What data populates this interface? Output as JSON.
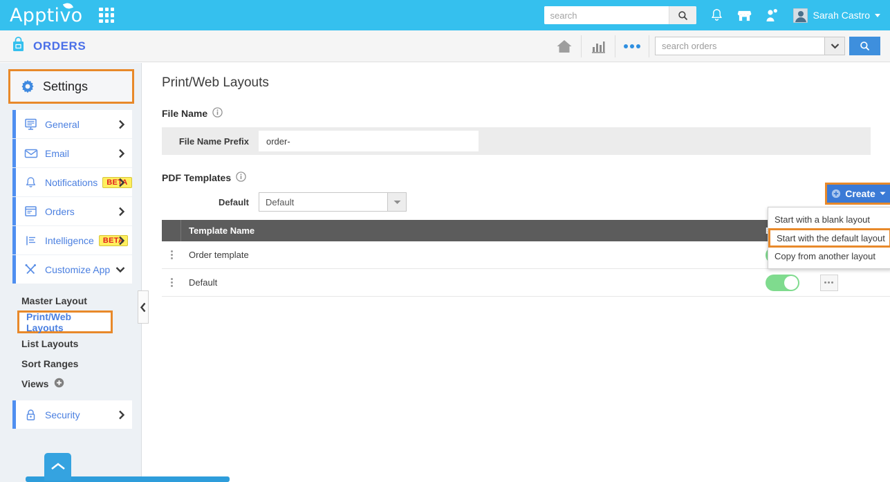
{
  "topbar": {
    "brand": "Apptivo",
    "grid_icon": "apps-grid-icon",
    "search_placeholder": "search",
    "search_value": "",
    "search_icon": "search-icon",
    "bell_icon": "notifications-bell-icon",
    "store_icon": "store-icon",
    "person_icon": "person-icon",
    "avatar_icon": "user-avatar",
    "username": "Sarah Castro",
    "caret_icon": "chevron-down-icon"
  },
  "appheader": {
    "app_icon": "shopping-bag-icon",
    "app_title": "ORDERS",
    "home_icon": "home-icon",
    "reports_icon": "bar-chart-icon",
    "more_icon": "more-dots-icon",
    "search_placeholder": "search orders",
    "search_value": "",
    "dropdown_icon": "chevron-down-icon",
    "search_button_icon": "search-icon"
  },
  "sidebar": {
    "header": {
      "label": "Settings",
      "icon": "gear-icon"
    },
    "items": [
      {
        "label": "General",
        "icon": "monitor-icon",
        "beta": "",
        "chevron": "chevron-right-icon"
      },
      {
        "label": "Email",
        "icon": "envelope-icon",
        "beta": "",
        "chevron": "chevron-right-icon"
      },
      {
        "label": "Notifications",
        "icon": "bell-icon",
        "beta": "BETA",
        "chevron": "chevron-right-icon"
      },
      {
        "label": "Orders",
        "icon": "document-icon",
        "beta": "",
        "chevron": "chevron-right-icon"
      },
      {
        "label": "Intelligence",
        "icon": "list-lines-icon",
        "beta": "BETA",
        "chevron": "chevron-right-icon"
      },
      {
        "label": "Customize App",
        "icon": "tools-icon",
        "beta": "",
        "chevron": "chevron-down-icon"
      }
    ],
    "sub_items": [
      {
        "label": "Master Layout",
        "active": false
      },
      {
        "label": "Print/Web Layouts",
        "active": true
      },
      {
        "label": "List Layouts",
        "active": false
      },
      {
        "label": "Sort Ranges",
        "active": false
      },
      {
        "label": "Views",
        "active": false,
        "plus_icon": "plus-circle-icon"
      }
    ],
    "security": {
      "label": "Security",
      "icon": "lock-icon",
      "chevron": "chevron-right-icon"
    },
    "collapse_icon": "chevron-left-icon",
    "scroll_top_icon": "chevron-up-icon"
  },
  "main": {
    "page_title": "Print/Web Layouts",
    "file_name_section": {
      "label": "File Name",
      "info_icon": "info-icon",
      "field_label": "File Name Prefix",
      "field_value": "order-"
    },
    "pdf_section": {
      "label": "PDF Templates",
      "info_icon": "info-icon",
      "select_label": "Default",
      "select_value": "Default",
      "select_arrow_icon": "caret-down-icon"
    },
    "create": {
      "label": "Create",
      "plus_icon": "plus-circle-icon",
      "caret_icon": "caret-down-icon",
      "menu": [
        {
          "label": "Start with a blank layout",
          "highlighted": false
        },
        {
          "label": "Start with the default layout",
          "highlighted": true
        },
        {
          "label": "Copy from another layout",
          "highlighted": false
        }
      ]
    },
    "table": {
      "columns": [
        "Template Name",
        "Enabled"
      ],
      "rows": [
        {
          "handle_icon": "drag-handle-icon",
          "name": "Order template",
          "enabled": true,
          "more": false
        },
        {
          "handle_icon": "drag-handle-icon",
          "name": "Default",
          "enabled": true,
          "more": true,
          "more_icon": "ellipsis-icon"
        }
      ]
    }
  },
  "colors": {
    "brand_blue": "#35c0ee",
    "accent_orange": "#e8892a",
    "link_blue": "#4a7fe0",
    "button_blue": "#3b7ad6",
    "toggle_green": "#7fdb8e",
    "table_header": "#5c5c5c",
    "beta_yellow": "#ffef5e",
    "beta_red": "#e02020"
  }
}
